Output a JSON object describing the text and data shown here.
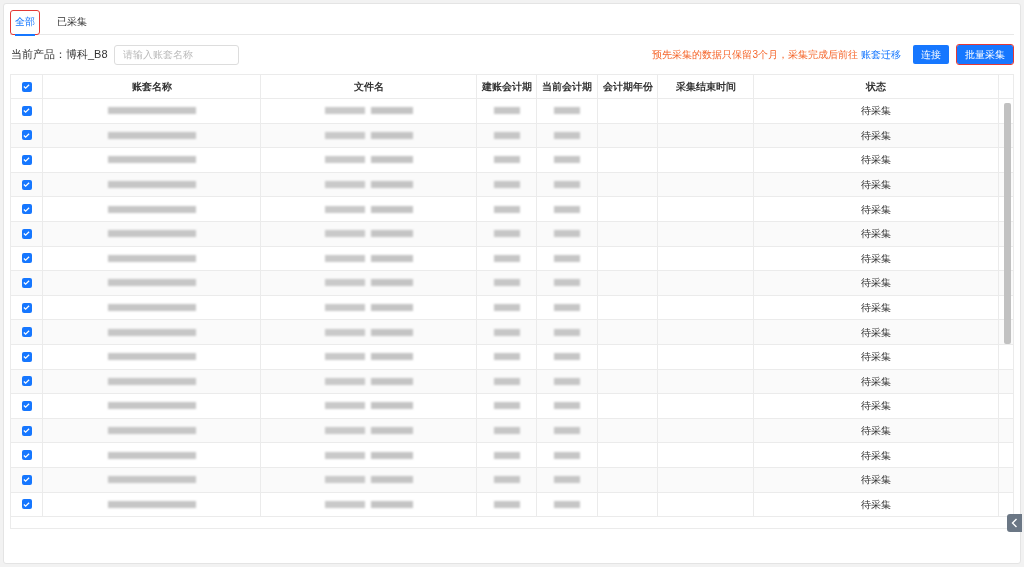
{
  "tabs": [
    {
      "label": "全部",
      "selected": true,
      "highlighted": true
    },
    {
      "label": "已采集",
      "selected": false,
      "highlighted": false
    }
  ],
  "toolbar": {
    "product_label": "当前产品：",
    "product_name": "博科_B8",
    "search": {
      "placeholder": "请输入账套名称"
    },
    "notice": "预先采集的数据只保留3个月，采集完成后前往",
    "notice_link": "账套迁移",
    "buttons": [
      {
        "label": "连接",
        "highlighted": false
      },
      {
        "label": "批量采集",
        "highlighted": true
      }
    ]
  },
  "table": {
    "all_checked": true,
    "columns": [
      "账套名称",
      "文件名",
      "建账会计期",
      "当前会计期",
      "会计期年份",
      "采集结束时间",
      "状态"
    ],
    "rows": [
      {
        "checked": true,
        "status": "待采集"
      },
      {
        "checked": true,
        "status": "待采集"
      },
      {
        "checked": true,
        "status": "待采集"
      },
      {
        "checked": true,
        "status": "待采集"
      },
      {
        "checked": true,
        "status": "待采集"
      },
      {
        "checked": true,
        "status": "待采集"
      },
      {
        "checked": true,
        "status": "待采集"
      },
      {
        "checked": true,
        "status": "待采集"
      },
      {
        "checked": true,
        "status": "待采集"
      },
      {
        "checked": true,
        "status": "待采集"
      },
      {
        "checked": true,
        "status": "待采集"
      },
      {
        "checked": true,
        "status": "待采集"
      },
      {
        "checked": true,
        "status": "待采集"
      },
      {
        "checked": true,
        "status": "待采集"
      },
      {
        "checked": true,
        "status": "待采集"
      },
      {
        "checked": true,
        "status": "待采集"
      },
      {
        "checked": true,
        "status": "待采集"
      }
    ]
  }
}
